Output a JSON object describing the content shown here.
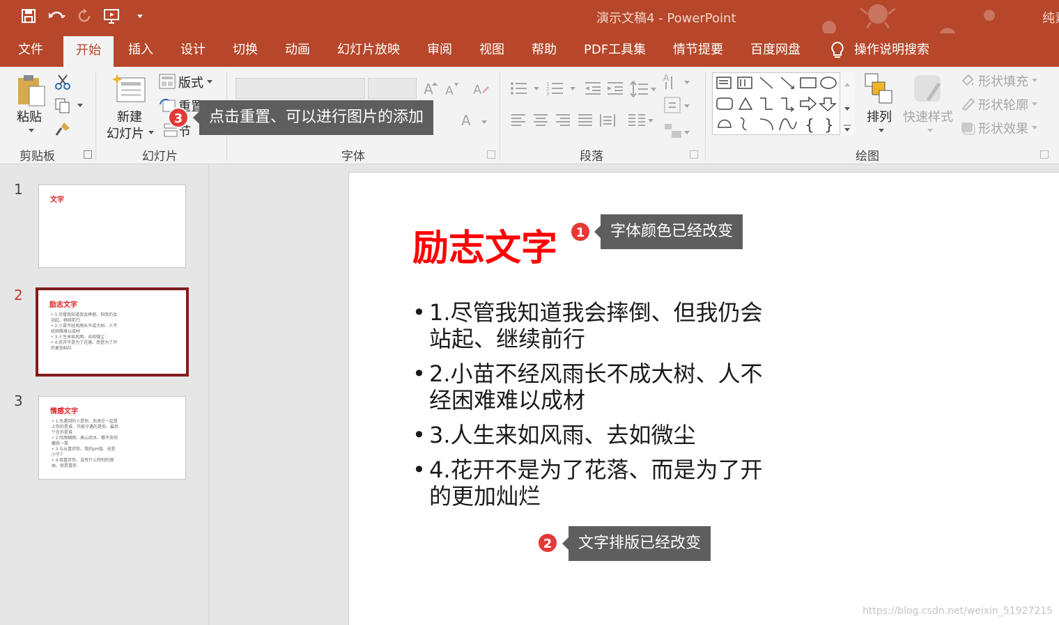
{
  "window": {
    "title": "演示文稿4 - PowerPoint",
    "user": "纯素"
  },
  "menu_tabs": [
    "文件",
    "开始",
    "插入",
    "设计",
    "切换",
    "动画",
    "幻灯片放映",
    "审阅",
    "视图",
    "帮助",
    "PDF工具集",
    "情节提要",
    "百度网盘"
  ],
  "active_tab": "开始",
  "tell_me": "操作说明搜索",
  "ribbon": {
    "clipboard": {
      "paste": "粘贴",
      "label": "剪贴板"
    },
    "slides": {
      "new_slide_line1": "新建",
      "new_slide_line2": "幻灯片",
      "layout": "版式",
      "reset": "重置",
      "section": "节",
      "label": "幻灯片"
    },
    "font": {
      "label": "字体"
    },
    "paragraph": {
      "label": "段落"
    },
    "drawing": {
      "arrange": "排列",
      "quick_styles": "快速样式",
      "shape_fill": "形状填充",
      "shape_outline": "形状轮廓",
      "shape_effects": "形状效果",
      "label": "绘图"
    }
  },
  "callouts": [
    {
      "number": "1",
      "text": "字体颜色已经改变"
    },
    {
      "number": "2",
      "text": "文字排版已经改变"
    },
    {
      "number": "3",
      "text": "点击重置、可以进行图片的添加"
    }
  ],
  "thumbnails": [
    {
      "number": "1",
      "title": "文字",
      "lines": []
    },
    {
      "number": "2",
      "title": "励志文字",
      "lines": [
        "• 1.尽管我知道我会摔倒、但我仍会站起、继续前行",
        "• 2.小苗不经风雨长不成大树、人不经困难难以成材",
        "• 3.人生来如风雨、去如微尘",
        "• 4.花开不是为了花落、而是为了开的更加灿烂"
      ]
    },
    {
      "number": "3",
      "title": "情感文字",
      "lines": [
        "• 1.先遇到的人是你、后来在一起是上你的是谁、只能守遇的是你、最后个在的是谁",
        "• 2.阵雨细雨、高山流水、都不及你藏我一笑",
        "• 3.与从喜欢你、我的pH值、总是小于7",
        "• 4.我喜欢你、没有什么特别的理由、就是喜欢"
      ]
    }
  ],
  "slide": {
    "title": "励志文字",
    "bullets": [
      "1.尽管我知道我会摔倒、但我仍会站起、继续前行",
      "2.小苗不经风雨长不成大树、人不经困难难以成材",
      "3.人生来如风雨、去如微尘",
      "4.花开不是为了花落、而是为了开的更加灿烂"
    ]
  },
  "watermark": "https://blog.csdn.net/weixin_51927215",
  "colors": {
    "accent": "#b7472a",
    "title_red": "#ff0000",
    "badge_red": "#e53935",
    "callout_bg": "#5e5e5e"
  }
}
